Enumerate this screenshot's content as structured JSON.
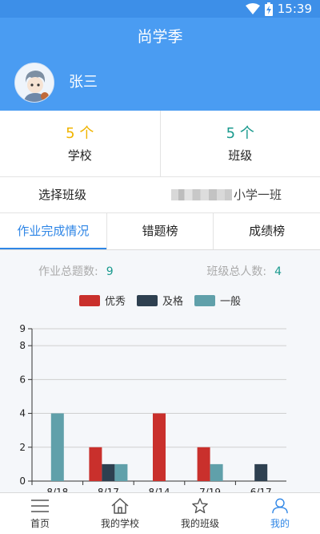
{
  "status_bar": {
    "time": "15:39",
    "wifi_icon": "wifi-icon",
    "battery_icon": "battery-charging-icon"
  },
  "app": {
    "title": "尚学季"
  },
  "user": {
    "name": "张三"
  },
  "stats": [
    {
      "value": "5 个",
      "label": "学校",
      "color": "#f0b400"
    },
    {
      "value": "5 个",
      "label": "班级",
      "color": "#1a9a8e"
    }
  ],
  "class_select": {
    "label": "选择班级",
    "value": "小学一班"
  },
  "tabs": [
    {
      "label": "作业完成情况",
      "active": true
    },
    {
      "label": "错题榜",
      "active": false
    },
    {
      "label": "成绩榜",
      "active": false
    }
  ],
  "summary": {
    "homework_label": "作业总题数:",
    "homework_count": "9",
    "students_label": "班级总人数:",
    "students_count": "4"
  },
  "legend": [
    {
      "name": "优秀",
      "color": "#c9302c"
    },
    {
      "name": "及格",
      "color": "#2e4050"
    },
    {
      "name": "一般",
      "color": "#60a0aa"
    }
  ],
  "chart_data": {
    "type": "bar",
    "categories": [
      "8/18",
      "8/17",
      "8/14",
      "7/19",
      "6/17"
    ],
    "series": [
      {
        "name": "优秀",
        "color": "#c9302c",
        "values": [
          0,
          2,
          4,
          2,
          0
        ]
      },
      {
        "name": "及格",
        "color": "#2e4050",
        "values": [
          0,
          1,
          0,
          0,
          1
        ]
      },
      {
        "name": "一般",
        "color": "#60a0aa",
        "values": [
          4,
          1,
          0,
          1,
          0
        ]
      }
    ],
    "y_ticks": [
      "0",
      "2",
      "4",
      "6",
      "8",
      "9"
    ],
    "ylim": [
      0,
      9
    ],
    "grid": true,
    "legend_position": "top"
  },
  "bottom_nav": [
    {
      "label": "首页",
      "icon": "menu-icon",
      "active": false
    },
    {
      "label": "我的学校",
      "icon": "home-icon",
      "active": false
    },
    {
      "label": "我的班级",
      "icon": "star-icon",
      "active": false
    },
    {
      "label": "我的",
      "icon": "person-icon",
      "active": true
    }
  ]
}
